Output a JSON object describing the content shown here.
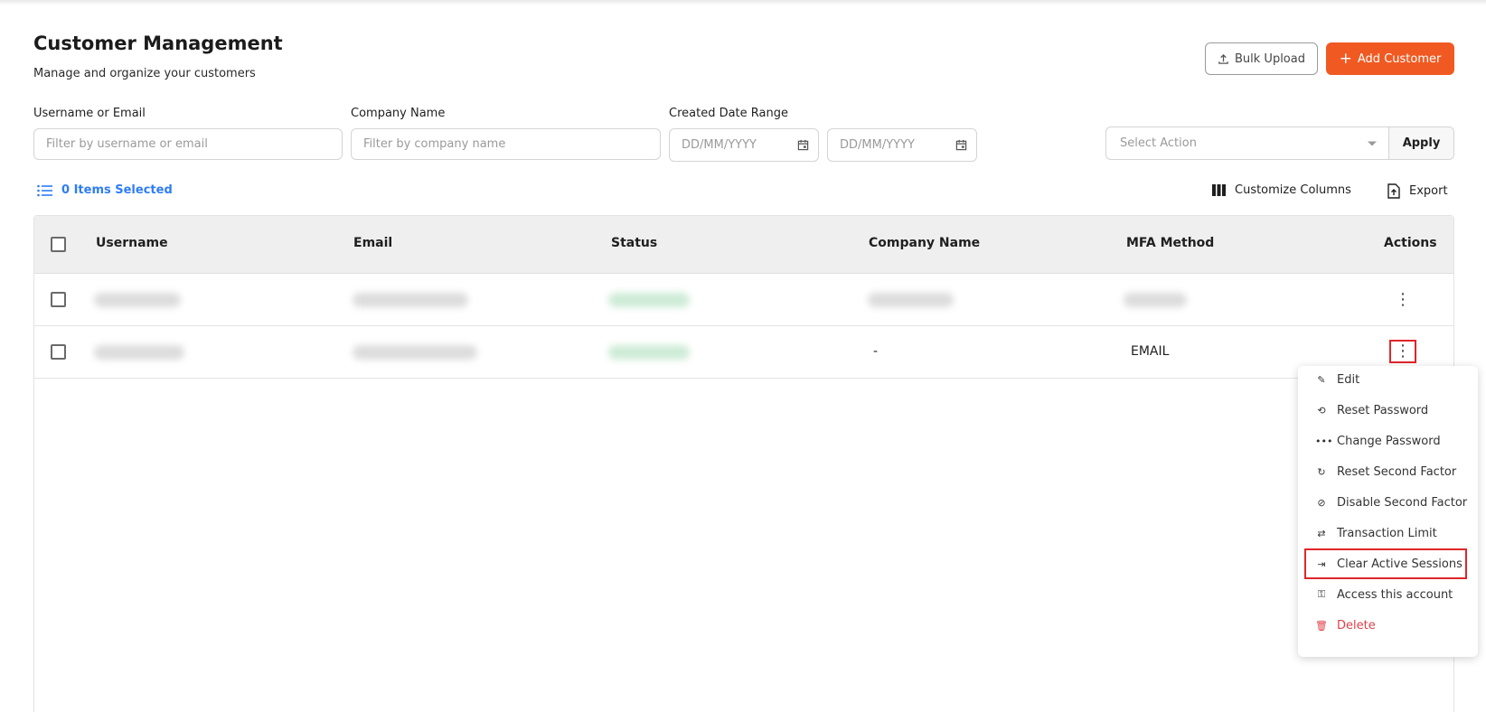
{
  "page": {
    "title": "Customer Management",
    "subtitle": "Manage and organize your customers"
  },
  "header_actions": {
    "bulk_upload": "Bulk Upload",
    "add_customer": "Add Customer"
  },
  "filters": {
    "username_label": "Username or Email",
    "username_placeholder": "Filter by username or email",
    "company_label": "Company Name",
    "company_placeholder": "Filter by company name",
    "date_label": "Created Date Range",
    "date_from_placeholder": "DD/MM/YYYY",
    "date_to_placeholder": "DD/MM/YYYY",
    "action_placeholder": "Select Action",
    "apply": "Apply"
  },
  "toolbar": {
    "selected": "0 Items Selected",
    "customize_columns": "Customize Columns",
    "export": "Export"
  },
  "table": {
    "columns": [
      "Username",
      "Email",
      "Status",
      "Company Name",
      "MFA Method",
      "Actions"
    ],
    "rows": [
      {
        "company": "",
        "mfa": ""
      },
      {
        "company": "-",
        "mfa": "EMAIL"
      }
    ]
  },
  "actions_menu": {
    "items": [
      {
        "label": "Edit",
        "icon": "pencil-icon"
      },
      {
        "label": "Reset Password",
        "icon": "reset-password-icon"
      },
      {
        "label": "Change Password",
        "icon": "password-dots-icon"
      },
      {
        "label": "Reset Second Factor",
        "icon": "refresh-icon"
      },
      {
        "label": "Disable Second Factor",
        "icon": "disable-icon"
      },
      {
        "label": "Transaction Limit",
        "icon": "transfer-icon"
      },
      {
        "label": "Clear Active Sessions",
        "icon": "logout-icon"
      },
      {
        "label": "Access this account",
        "icon": "access-icon"
      },
      {
        "label": "Delete",
        "icon": "trash-icon"
      }
    ]
  },
  "colors": {
    "primary": "#f05a22",
    "link": "#2e7cf6",
    "danger": "#e0414a",
    "highlight": "#e0262a"
  }
}
